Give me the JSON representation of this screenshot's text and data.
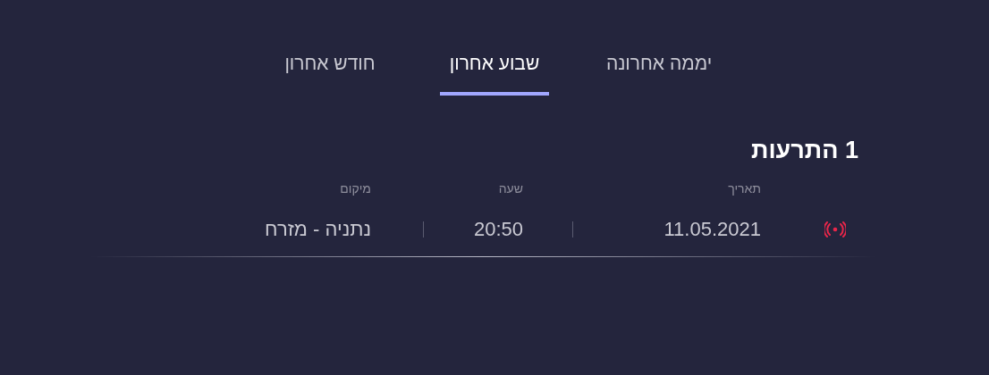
{
  "tabs": [
    {
      "label": "יממה אחרונה",
      "selected": false
    },
    {
      "label": "שבוע אחרון",
      "selected": true
    },
    {
      "label": "חודש אחרון",
      "selected": false
    }
  ],
  "alerts": {
    "title": "1 התרעות",
    "columns": [
      "תאריך",
      "שעה",
      "מיקום"
    ],
    "rows": [
      {
        "date": "11.05.2021",
        "time": "20:50",
        "location": "נתניה - מזרח"
      }
    ]
  }
}
